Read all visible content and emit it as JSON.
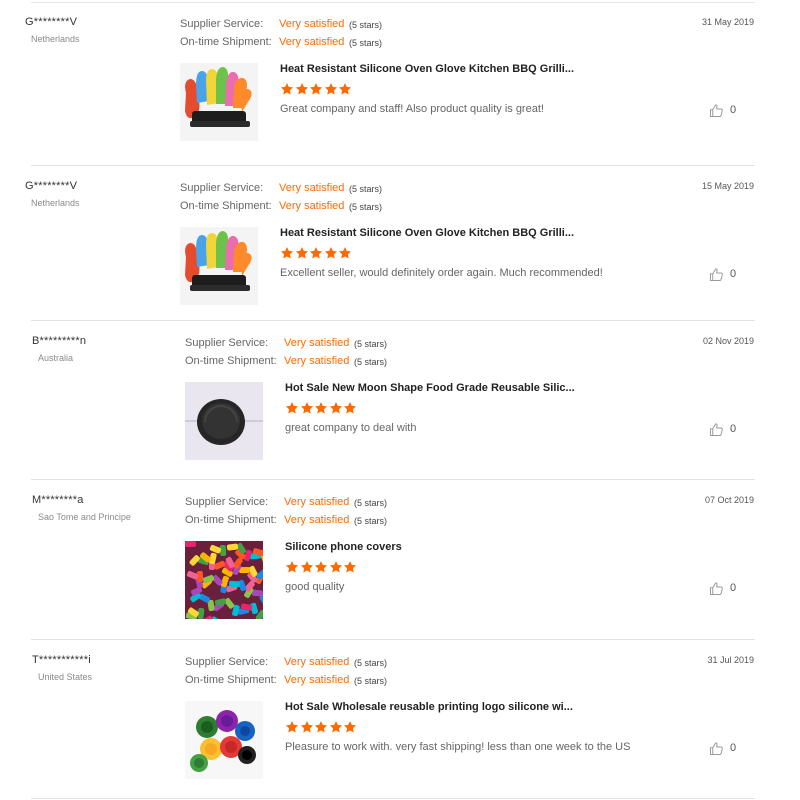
{
  "labels": {
    "supplier_service": "Supplier Service:",
    "ontime_shipment": "On-time Shipment:"
  },
  "colors": {
    "accent": "#ff6a00",
    "separator": "#e2e2e2"
  },
  "reviews": [
    {
      "buyer": "G********V",
      "country": "Netherlands",
      "date": "31 May 2019",
      "supplier_value": "Very satisfied",
      "supplier_stars": "(5 stars)",
      "shipment_value": "Very satisfied",
      "shipment_stars": "(5 stars)",
      "product_title": "Heat Resistant Silicone Oven Glove Kitchen BBQ Grilli...",
      "product_image": "silicone-gloves",
      "rating": 5,
      "comment": "Great company and staff! Also product quality is great!",
      "likes": "0"
    },
    {
      "buyer": "G********V",
      "country": "Netherlands",
      "date": "15 May 2019",
      "supplier_value": "Very satisfied",
      "supplier_stars": "(5 stars)",
      "shipment_value": "Very satisfied",
      "shipment_stars": "(5 stars)",
      "product_title": "Heat Resistant Silicone Oven Glove Kitchen BBQ Grilli...",
      "product_image": "silicone-gloves",
      "rating": 5,
      "comment": "Excellent seller, would definitely order again. Much recommended!",
      "likes": "0"
    },
    {
      "buyer": "B*********n",
      "country": "Australia",
      "date": "02 Nov 2019",
      "supplier_value": "Very satisfied",
      "supplier_stars": "(5 stars)",
      "shipment_value": "Very satisfied",
      "shipment_stars": "(5 stars)",
      "product_title": "Hot Sale New Moon Shape Food Grade Reusable Silic...",
      "product_image": "moon-lid",
      "rating": 5,
      "comment": "great company to deal with",
      "likes": "0"
    },
    {
      "buyer": "M********a",
      "country": "Sao Tome and Principe",
      "date": "07 Oct 2019",
      "supplier_value": "Very satisfied",
      "supplier_stars": "(5 stars)",
      "shipment_value": "Very satisfied",
      "shipment_stars": "(5 stars)",
      "product_title": "Silicone phone covers",
      "product_image": "phone-covers",
      "rating": 5,
      "comment": "good quality",
      "likes": "0"
    },
    {
      "buyer": "T***********i",
      "country": "United States",
      "date": "31 Jul 2019",
      "supplier_value": "Very satisfied",
      "supplier_stars": "(5 stars)",
      "shipment_value": "Very satisfied",
      "shipment_stars": "(5 stars)",
      "product_title": "Hot Sale Wholesale reusable printing logo silicone wi...",
      "product_image": "wine-caps",
      "rating": 5,
      "comment": "Pleasure to work with. very fast shipping! less than one week to the US",
      "likes": "0"
    }
  ]
}
